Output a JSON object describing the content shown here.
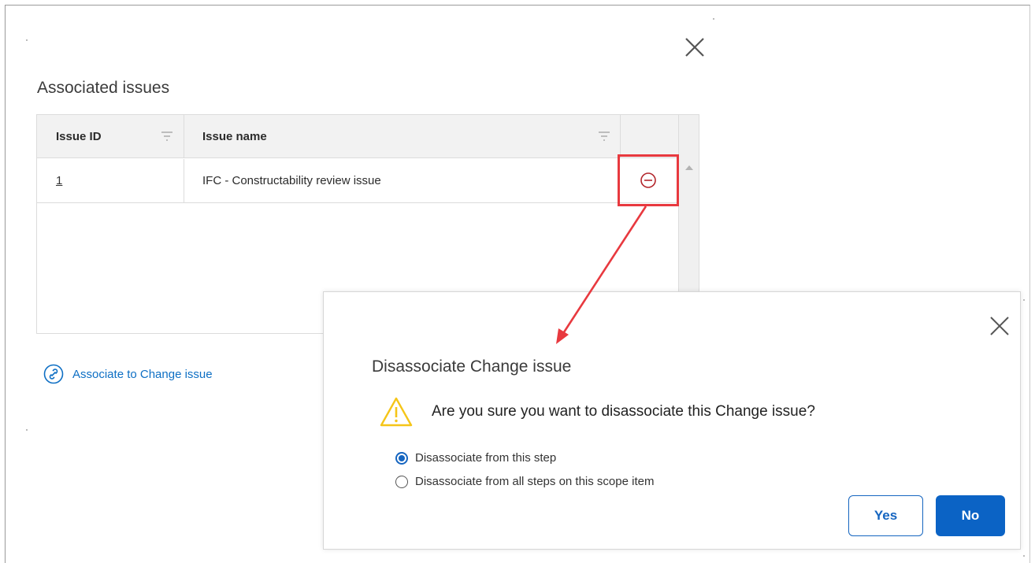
{
  "panel": {
    "section_title": "Associated issues",
    "close_icon": "close-icon"
  },
  "grid": {
    "columns": [
      {
        "label": "Issue ID"
      },
      {
        "label": "Issue name"
      }
    ],
    "rows": [
      {
        "id": "1",
        "name": "IFC - Constructability review issue",
        "action_icon": "minus-circle-icon"
      }
    ]
  },
  "associate_link": {
    "label": "Associate to Change issue",
    "icon": "link-icon"
  },
  "dialog": {
    "title": "Disassociate Change issue",
    "question": "Are you sure you want to disassociate this Change issue?",
    "warning_icon": "warning-icon",
    "options": [
      {
        "label": "Disassociate from this step",
        "checked": true
      },
      {
        "label": "Disassociate from all steps on this scope item",
        "checked": false
      }
    ],
    "yes_label": "Yes",
    "no_label": "No"
  },
  "colors": {
    "accent_blue": "#0b63c5",
    "link_blue": "#0e6fc4",
    "highlight_red": "#e8393f",
    "warning_yellow": "#f5c518",
    "remove_icon_red": "#b3262c"
  }
}
